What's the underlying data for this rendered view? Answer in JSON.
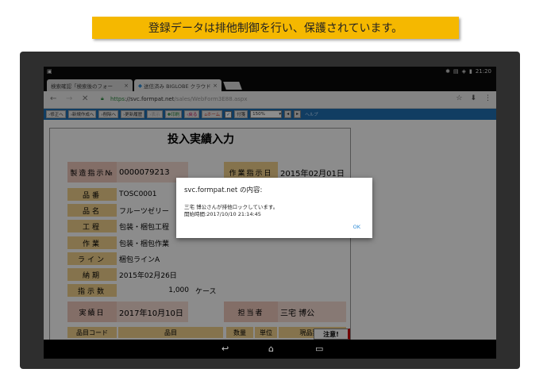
{
  "banner": {
    "text": "登録データは排他制御を行い、保護されています。"
  },
  "statusbar": {
    "time": "21:20"
  },
  "browser": {
    "tabs": [
      {
        "label": "検索確認「検索後のフォー",
        "close": "×"
      },
      {
        "label": "送信済み BIGLOBE クラウド",
        "close": "×"
      }
    ],
    "url_secure": "https",
    "url_host": "://svc.formpat.net",
    "url_path": "/sales/WebForm3E88.aspx"
  },
  "toolbar": {
    "buttons": [
      "›修正へ",
      "›新規作成へ",
      "›削除へ",
      "›更新履歴",
      "›表示",
      "✚印刷",
      "‹戻る",
      "⌂ホーム"
    ],
    "check_label": "付箋",
    "zoom": "150%",
    "help": "ヘルプ"
  },
  "form": {
    "title": "投入実績入力",
    "order_no_label": "製造指示№",
    "order_no": "0000079213",
    "order_date_label": "作業指示日",
    "order_date": "2015年02月01日",
    "part_no_label": "品番",
    "part_no": "TOSC0001",
    "part_name_label": "品名",
    "part_name": "フルーツゼリー",
    "process_label": "工程",
    "process": "包装・梱包工程",
    "work_label": "作業",
    "work": "包装・梱包作業",
    "line_label": "ライン",
    "line": "梱包ラインA",
    "due_label": "納期",
    "due": "2015年02月26日",
    "qty_label": "指示数",
    "qty": "1,000",
    "qty_unit": "ケース",
    "actual_date_label": "実績日",
    "actual_date": "2017年10月10日",
    "person_label": "担当者",
    "person": "三宅 博公",
    "table_headers": [
      "品目コード",
      "品目",
      "数量",
      "単位",
      "現品票№"
    ],
    "notice": "注意!"
  },
  "dialog": {
    "title": "svc.formpat.net の内容:",
    "message": "三宅 博公さんが排他ロックしています。",
    "start_time": "開始時間:2017/10/10 21:14:45",
    "ok": "OK"
  }
}
